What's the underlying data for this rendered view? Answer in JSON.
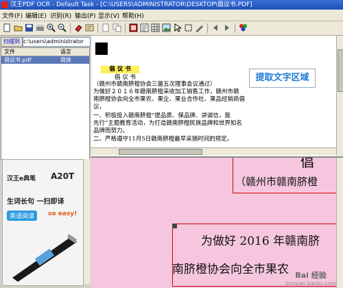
{
  "window": {
    "title": "汉王PDF OCR - Default Task - [C:\\USERS\\ADMINISTRATOR\\DESKTOP\\倡议书.PDF]"
  },
  "menu": [
    "文件(F)",
    "编辑(E)",
    "识别(R)",
    "输出(P)",
    "显示(V)",
    "帮助(H)"
  ],
  "left_panel": {
    "scan_button": "扫描到",
    "path_value": "c:\\users\\administrator",
    "columns": [
      "文件",
      "语言"
    ],
    "files": [
      {
        "name": "倡议书.pdf",
        "language": "简体"
      }
    ]
  },
  "ad": {
    "brand": "汉王e典笔",
    "model": "A20T",
    "tagline": "生词长句 一扫即译",
    "sub": "英语阅读",
    "slogan": "so easy!"
  },
  "document": {
    "title": "倡  议  书",
    "lines": [
      "倡    议    书",
      "（赣州市赣南脐橙协会三届五次理事会议通过）",
      "    为做好２０１６年赣南脐橙采收加工销售工作，赣州市赣",
      "南脐橙协会向全市果农、果企、果业合作社、果品经销商倡",
      "议，",
      "    一、积极投入赣南脐橙“提品质、保品牌、讲诚信，我",
      "先行”主题教育活动，为打造赣南脐橙民族品牌和世界知名",
      "品牌而努力。",
      "    二、严格遵守11月5日赣南脐橙最早采摘时间的规定。"
    ]
  },
  "annotation": "提取文字区域",
  "zoom": {
    "line1": "（赣州市赣南脐橙",
    "line2": "为做好 2016 年赣南脐",
    "line3": "南脐橙协会向全市果农",
    "corner_char": "倡"
  },
  "watermark": {
    "name": "Bai 经验",
    "url": "jingyan.baidu.com"
  },
  "colors": {
    "title_bar": "#1f4fb8",
    "selection": "#5a78b8",
    "annotation_text": "#1e7cd8",
    "zoom_bg": "#f6c6de",
    "box_red": "#cc0000"
  }
}
